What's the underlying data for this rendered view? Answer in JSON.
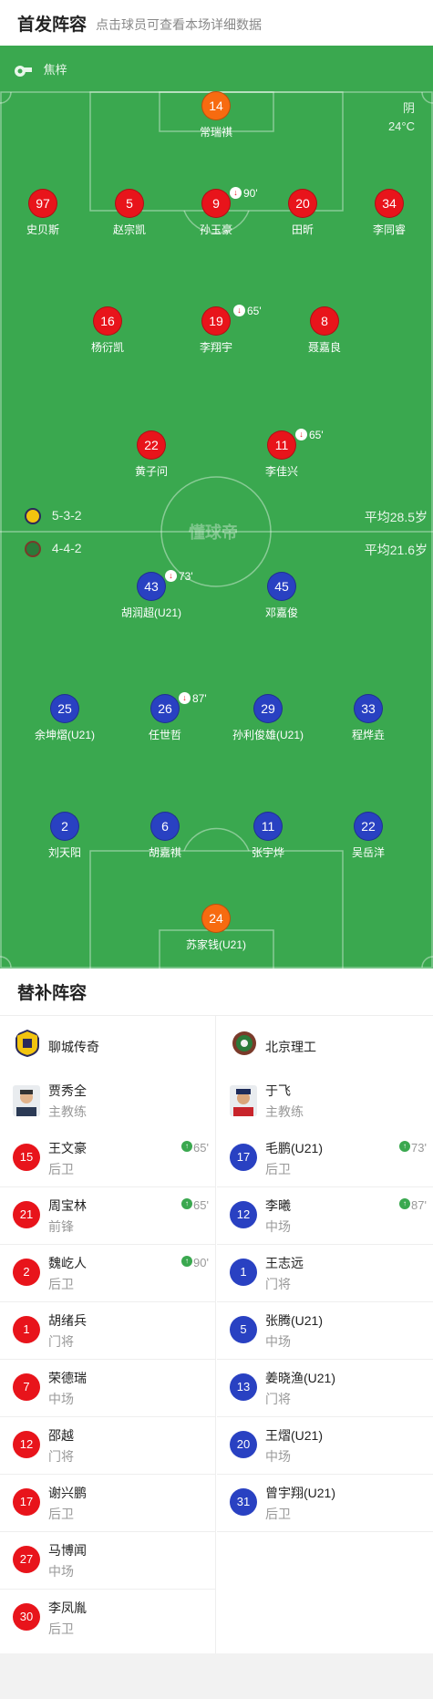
{
  "header": {
    "title": "首发阵容",
    "subtitle": "点击球员可查看本场详细数据"
  },
  "pitch": {
    "referee": "焦梓",
    "weather": "阴",
    "temperature": "24°C",
    "watermark": "懂球帝",
    "home_team": {
      "formation": "5-3-2",
      "avg_age": "平均28.5岁"
    },
    "away_team": {
      "formation": "4-4-2",
      "avg_age": "平均21.6岁"
    },
    "home_players": [
      {
        "num": "14",
        "name": "常瑞祺",
        "color": "orange"
      },
      {
        "num": "97",
        "name": "史贝斯",
        "color": "red"
      },
      {
        "num": "5",
        "name": "赵宗凯",
        "color": "red"
      },
      {
        "num": "9",
        "name": "孙玉豪",
        "color": "red",
        "sub": "90'"
      },
      {
        "num": "20",
        "name": "田昕",
        "color": "red"
      },
      {
        "num": "34",
        "name": "李同睿",
        "color": "red"
      },
      {
        "num": "16",
        "name": "杨衍凯",
        "color": "red"
      },
      {
        "num": "19",
        "name": "李翔宇",
        "color": "red",
        "sub": "65'"
      },
      {
        "num": "8",
        "name": "聂嘉良",
        "color": "red"
      },
      {
        "num": "22",
        "name": "黄子问",
        "color": "red"
      },
      {
        "num": "11",
        "name": "李佳兴",
        "color": "red",
        "sub": "65'"
      }
    ],
    "away_players": [
      {
        "num": "43",
        "name": "胡润超(U21)",
        "color": "blue",
        "sub": "73'"
      },
      {
        "num": "45",
        "name": "邓嘉俊",
        "color": "blue"
      },
      {
        "num": "25",
        "name": "余坤熠(U21)",
        "color": "blue"
      },
      {
        "num": "26",
        "name": "任世哲",
        "color": "blue",
        "sub": "87'"
      },
      {
        "num": "29",
        "name": "孙利俊雄(U21)",
        "color": "blue"
      },
      {
        "num": "33",
        "name": "程烨垚",
        "color": "blue"
      },
      {
        "num": "2",
        "name": "刘天阳",
        "color": "blue"
      },
      {
        "num": "6",
        "name": "胡嘉祺",
        "color": "blue"
      },
      {
        "num": "11",
        "name": "张宇烨",
        "color": "blue"
      },
      {
        "num": "22",
        "name": "吴岳洋",
        "color": "blue"
      },
      {
        "num": "24",
        "name": "苏家钱(U21)",
        "color": "orange"
      }
    ]
  },
  "bench": {
    "title": "替补阵容",
    "home": {
      "team_name": "聊城传奇",
      "coach": {
        "name": "贾秀全",
        "role": "主教练"
      },
      "players": [
        {
          "num": "15",
          "name": "王文豪",
          "pos": "后卫",
          "sub_in": "65'"
        },
        {
          "num": "21",
          "name": "周宝林",
          "pos": "前锋",
          "sub_in": "65'"
        },
        {
          "num": "2",
          "name": "魏屹人",
          "pos": "后卫",
          "sub_in": "90'"
        },
        {
          "num": "1",
          "name": "胡绪兵",
          "pos": "门将"
        },
        {
          "num": "7",
          "name": "荣德瑞",
          "pos": "中场"
        },
        {
          "num": "12",
          "name": "邵越",
          "pos": "门将"
        },
        {
          "num": "17",
          "name": "谢兴鹏",
          "pos": "后卫"
        },
        {
          "num": "27",
          "name": "马博闻",
          "pos": "中场"
        },
        {
          "num": "30",
          "name": "李凤胤",
          "pos": "后卫"
        }
      ]
    },
    "away": {
      "team_name": "北京理工",
      "coach": {
        "name": "于飞",
        "role": "主教练"
      },
      "players": [
        {
          "num": "17",
          "name": "毛鹏(U21)",
          "pos": "后卫",
          "sub_in": "73'"
        },
        {
          "num": "12",
          "name": "李曦",
          "pos": "中场",
          "sub_in": "87'"
        },
        {
          "num": "1",
          "name": "王志远",
          "pos": "门将"
        },
        {
          "num": "5",
          "name": "张腾(U21)",
          "pos": "中场"
        },
        {
          "num": "13",
          "name": "姜晓渔(U21)",
          "pos": "门将"
        },
        {
          "num": "20",
          "name": "王熠(U21)",
          "pos": "中场"
        },
        {
          "num": "31",
          "name": "曾宇翔(U21)",
          "pos": "后卫"
        }
      ]
    }
  },
  "colors": {
    "pitch": "#3aa84f",
    "red": "#e8141b",
    "blue": "#2941c2",
    "orange": "#f76b10",
    "yellow_card": "#f7d71b"
  }
}
